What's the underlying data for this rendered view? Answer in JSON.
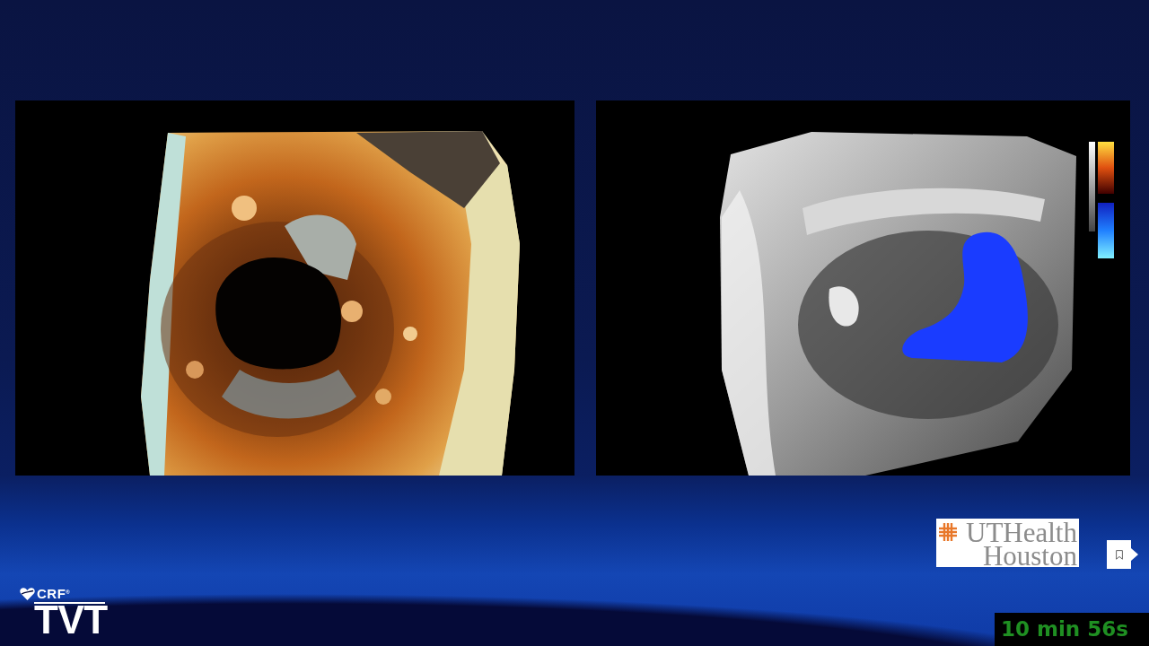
{
  "slide": {
    "videos": [
      {
        "kind": "valve"
      },
      {
        "kind": "doppler"
      }
    ]
  },
  "sponsor_logo": {
    "name": "UTHealth",
    "location": "Houston"
  },
  "brand_logo": {
    "organization": "CRF$^{®}$",
    "program": "TVT"
  },
  "timer": {
    "text": "10 min 56s"
  }
}
